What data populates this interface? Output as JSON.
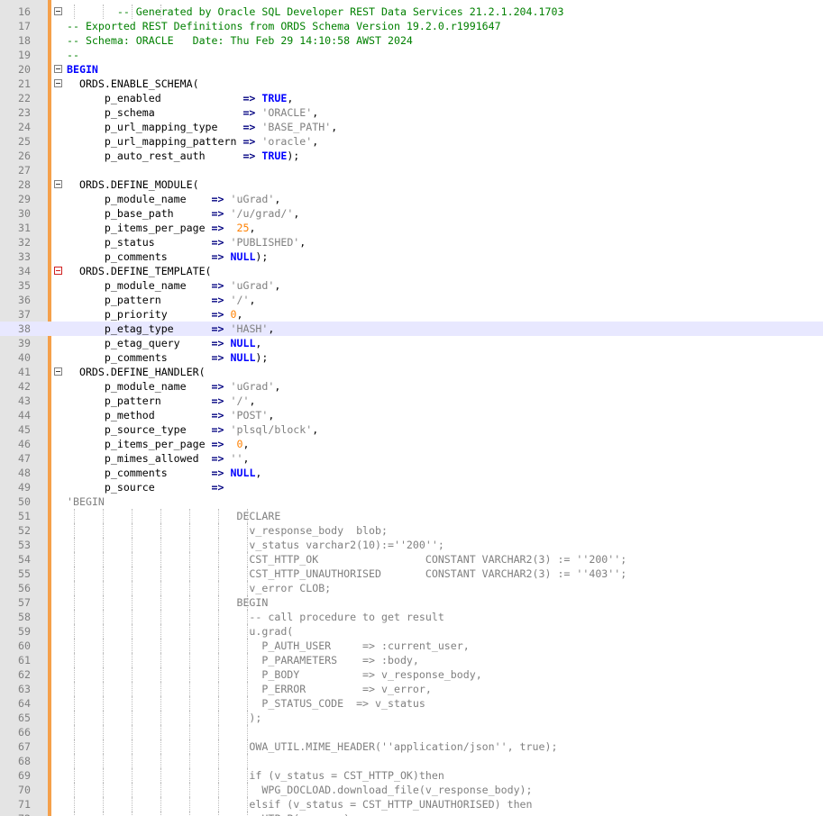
{
  "editor": {
    "active_line": 38,
    "colors": {
      "comment": "#008000",
      "keyword": "#0000ff",
      "string": "#808080",
      "number": "#ff8000",
      "operator": "#000080",
      "highlight": "#e8e8ff",
      "change_bar": "#f5a04a"
    },
    "lines": [
      {
        "n": "16",
        "fold": "box",
        "guides": 4,
        "tokens": [
          [
            "comment",
            "        -- Generated by Oracle SQL Developer REST Data Services 21.2.1.204.1703"
          ]
        ]
      },
      {
        "n": "17",
        "tokens": [
          [
            "comment",
            "-- Exported REST Definitions from ORDS Schema Version 19.2.0.r1991647"
          ]
        ]
      },
      {
        "n": "18",
        "tokens": [
          [
            "comment",
            "-- Schema: ORACLE   Date: Thu Feb 29 14:10:58 AWST 2024"
          ]
        ]
      },
      {
        "n": "19",
        "tokens": [
          [
            "comment",
            "--"
          ]
        ]
      },
      {
        "n": "20",
        "fold": "box",
        "tokens": [
          [
            "keyword",
            "BEGIN"
          ]
        ]
      },
      {
        "n": "21",
        "fold": "box",
        "tokens": [
          [
            "plain",
            "  ORDS.ENABLE_SCHEMA("
          ]
        ]
      },
      {
        "n": "22",
        "tokens": [
          [
            "plain",
            "      p_enabled             "
          ],
          [
            "operator",
            "=> "
          ],
          [
            "keyword",
            "TRUE"
          ],
          [
            "plain",
            ","
          ]
        ]
      },
      {
        "n": "23",
        "tokens": [
          [
            "plain",
            "      p_schema              "
          ],
          [
            "operator",
            "=> "
          ],
          [
            "string",
            "'ORACLE'"
          ],
          [
            "plain",
            ","
          ]
        ]
      },
      {
        "n": "24",
        "tokens": [
          [
            "plain",
            "      p_url_mapping_type    "
          ],
          [
            "operator",
            "=> "
          ],
          [
            "string",
            "'BASE_PATH'"
          ],
          [
            "plain",
            ","
          ]
        ]
      },
      {
        "n": "25",
        "tokens": [
          [
            "plain",
            "      p_url_mapping_pattern "
          ],
          [
            "operator",
            "=> "
          ],
          [
            "string",
            "'oracle'"
          ],
          [
            "plain",
            ","
          ]
        ]
      },
      {
        "n": "26",
        "tokens": [
          [
            "plain",
            "      p_auto_rest_auth      "
          ],
          [
            "operator",
            "=> "
          ],
          [
            "keyword",
            "TRUE"
          ],
          [
            "plain",
            ");"
          ]
        ]
      },
      {
        "n": "27",
        "tokens": []
      },
      {
        "n": "28",
        "fold": "box",
        "tokens": [
          [
            "plain",
            "  ORDS.DEFINE_MODULE("
          ]
        ]
      },
      {
        "n": "29",
        "tokens": [
          [
            "plain",
            "      p_module_name    "
          ],
          [
            "operator",
            "=> "
          ],
          [
            "string",
            "'uGrad'"
          ],
          [
            "plain",
            ","
          ]
        ]
      },
      {
        "n": "30",
        "tokens": [
          [
            "plain",
            "      p_base_path      "
          ],
          [
            "operator",
            "=> "
          ],
          [
            "string",
            "'/u/grad/'"
          ],
          [
            "plain",
            ","
          ]
        ]
      },
      {
        "n": "31",
        "tokens": [
          [
            "plain",
            "      p_items_per_page "
          ],
          [
            "operator",
            "=>  "
          ],
          [
            "number",
            "25"
          ],
          [
            "plain",
            ","
          ]
        ]
      },
      {
        "n": "32",
        "tokens": [
          [
            "plain",
            "      p_status         "
          ],
          [
            "operator",
            "=> "
          ],
          [
            "string",
            "'PUBLISHED'"
          ],
          [
            "plain",
            ","
          ]
        ]
      },
      {
        "n": "33",
        "tokens": [
          [
            "plain",
            "      p_comments       "
          ],
          [
            "operator",
            "=> "
          ],
          [
            "keyword",
            "NULL"
          ],
          [
            "plain",
            ");"
          ]
        ]
      },
      {
        "n": "34",
        "fold": "red",
        "tokens": [
          [
            "plain",
            "  ORDS.DEFINE_TEMPLATE("
          ]
        ]
      },
      {
        "n": "35",
        "tokens": [
          [
            "plain",
            "      p_module_name    "
          ],
          [
            "operator",
            "=> "
          ],
          [
            "string",
            "'uGrad'"
          ],
          [
            "plain",
            ","
          ]
        ]
      },
      {
        "n": "36",
        "tokens": [
          [
            "plain",
            "      p_pattern        "
          ],
          [
            "operator",
            "=> "
          ],
          [
            "string",
            "'/'"
          ],
          [
            "plain",
            ","
          ]
        ]
      },
      {
        "n": "37",
        "tokens": [
          [
            "plain",
            "      p_priority       "
          ],
          [
            "operator",
            "=> "
          ],
          [
            "number",
            "0"
          ],
          [
            "plain",
            ","
          ]
        ]
      },
      {
        "n": "38",
        "tokens": [
          [
            "plain",
            "      p_etag_type      "
          ],
          [
            "operator",
            "=> "
          ],
          [
            "string",
            "'HASH'"
          ],
          [
            "plain",
            ","
          ]
        ]
      },
      {
        "n": "39",
        "tokens": [
          [
            "plain",
            "      p_etag_query     "
          ],
          [
            "operator",
            "=> "
          ],
          [
            "keyword",
            "NULL"
          ],
          [
            "plain",
            ","
          ]
        ]
      },
      {
        "n": "40",
        "tokens": [
          [
            "plain",
            "      p_comments       "
          ],
          [
            "operator",
            "=> "
          ],
          [
            "keyword",
            "NULL"
          ],
          [
            "plain",
            ");"
          ]
        ]
      },
      {
        "n": "41",
        "fold": "box",
        "tokens": [
          [
            "plain",
            "  ORDS.DEFINE_HANDLER("
          ]
        ]
      },
      {
        "n": "42",
        "tokens": [
          [
            "plain",
            "      p_module_name    "
          ],
          [
            "operator",
            "=> "
          ],
          [
            "string",
            "'uGrad'"
          ],
          [
            "plain",
            ","
          ]
        ]
      },
      {
        "n": "43",
        "tokens": [
          [
            "plain",
            "      p_pattern        "
          ],
          [
            "operator",
            "=> "
          ],
          [
            "string",
            "'/'"
          ],
          [
            "plain",
            ","
          ]
        ]
      },
      {
        "n": "44",
        "tokens": [
          [
            "plain",
            "      p_method         "
          ],
          [
            "operator",
            "=> "
          ],
          [
            "string",
            "'POST'"
          ],
          [
            "plain",
            ","
          ]
        ]
      },
      {
        "n": "45",
        "tokens": [
          [
            "plain",
            "      p_source_type    "
          ],
          [
            "operator",
            "=> "
          ],
          [
            "string",
            "'plsql/block'"
          ],
          [
            "plain",
            ","
          ]
        ]
      },
      {
        "n": "46",
        "tokens": [
          [
            "plain",
            "      p_items_per_page "
          ],
          [
            "operator",
            "=>  "
          ],
          [
            "number",
            "0"
          ],
          [
            "plain",
            ","
          ]
        ]
      },
      {
        "n": "47",
        "tokens": [
          [
            "plain",
            "      p_mimes_allowed  "
          ],
          [
            "operator",
            "=> "
          ],
          [
            "string",
            "''"
          ],
          [
            "plain",
            ","
          ]
        ]
      },
      {
        "n": "48",
        "tokens": [
          [
            "plain",
            "      p_comments       "
          ],
          [
            "operator",
            "=> "
          ],
          [
            "keyword",
            "NULL"
          ],
          [
            "plain",
            ","
          ]
        ]
      },
      {
        "n": "49",
        "tokens": [
          [
            "plain",
            "      p_source         "
          ],
          [
            "operator",
            "=>"
          ]
        ]
      },
      {
        "n": "50",
        "tokens": [
          [
            "string",
            "'BEGIN"
          ]
        ]
      },
      {
        "n": "51",
        "guides": 7,
        "tokens": [
          [
            "string",
            "                           DECLARE"
          ]
        ]
      },
      {
        "n": "52",
        "guides": 7,
        "tokens": [
          [
            "string",
            "                             v_response_body  blob;"
          ]
        ]
      },
      {
        "n": "53",
        "guides": 7,
        "tokens": [
          [
            "string",
            "                             v_status varchar2(10):=''200'';"
          ]
        ]
      },
      {
        "n": "54",
        "guides": 7,
        "tokens": [
          [
            "string",
            "                             CST_HTTP_OK                 CONSTANT VARCHAR2(3) := ''200'';"
          ]
        ]
      },
      {
        "n": "55",
        "guides": 7,
        "tokens": [
          [
            "string",
            "                             CST_HTTP_UNAUTHORISED       CONSTANT VARCHAR2(3) := ''403'';"
          ]
        ]
      },
      {
        "n": "56",
        "guides": 7,
        "tokens": [
          [
            "string",
            "                             v_error CLOB;"
          ]
        ]
      },
      {
        "n": "57",
        "guides": 7,
        "tokens": [
          [
            "string",
            "                           BEGIN"
          ]
        ]
      },
      {
        "n": "58",
        "guides": 7,
        "tokens": [
          [
            "string",
            "                             -- call procedure to get result"
          ]
        ]
      },
      {
        "n": "59",
        "guides": 7,
        "tokens": [
          [
            "string",
            "                             u.grad("
          ]
        ]
      },
      {
        "n": "60",
        "guides": 7,
        "tokens": [
          [
            "string",
            "                               P_AUTH_USER     => :current_user,"
          ]
        ]
      },
      {
        "n": "61",
        "guides": 7,
        "tokens": [
          [
            "string",
            "                               P_PARAMETERS    => :body,"
          ]
        ]
      },
      {
        "n": "62",
        "guides": 7,
        "tokens": [
          [
            "string",
            "                               P_BODY          => v_response_body,"
          ]
        ]
      },
      {
        "n": "63",
        "guides": 7,
        "tokens": [
          [
            "string",
            "                               P_ERROR         => v_error,"
          ]
        ]
      },
      {
        "n": "64",
        "guides": 7,
        "tokens": [
          [
            "string",
            "                               P_STATUS_CODE  => v_status"
          ]
        ]
      },
      {
        "n": "65",
        "guides": 7,
        "tokens": [
          [
            "string",
            "                             );"
          ]
        ]
      },
      {
        "n": "66",
        "guides": 7,
        "tokens": []
      },
      {
        "n": "67",
        "guides": 7,
        "tokens": [
          [
            "string",
            "                             OWA_UTIL.MIME_HEADER(''application/json'', true);"
          ]
        ]
      },
      {
        "n": "68",
        "guides": 7,
        "tokens": []
      },
      {
        "n": "69",
        "guides": 7,
        "tokens": [
          [
            "string",
            "                             if (v_status = CST_HTTP_OK)then"
          ]
        ]
      },
      {
        "n": "70",
        "guides": 7,
        "tokens": [
          [
            "string",
            "                               WPG_DOCLOAD.download_file(v_response_body);"
          ]
        ]
      },
      {
        "n": "71",
        "guides": 7,
        "tokens": [
          [
            "string",
            "                             elsif (v_status = CST_HTTP_UNAUTHORISED) then"
          ]
        ]
      },
      {
        "n": "72",
        "guides": 7,
        "tokens": [
          [
            "string",
            "                               HTP.P(v_error);"
          ]
        ]
      }
    ]
  }
}
